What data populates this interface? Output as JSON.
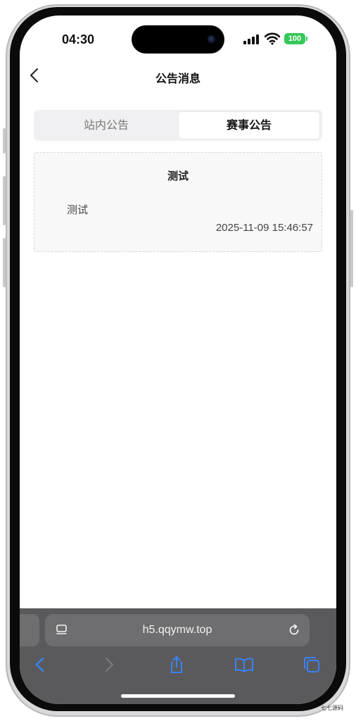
{
  "status_bar": {
    "time": "04:30",
    "battery": "100"
  },
  "nav": {
    "title": "公告消息"
  },
  "tabs": [
    {
      "label": "站内公告",
      "active": false
    },
    {
      "label": "赛事公告",
      "active": true
    }
  ],
  "notice": {
    "title": "测试",
    "body": "测试",
    "time": "2025-11-09 15:46:57"
  },
  "browser": {
    "url": "h5.qqymw.top"
  },
  "watermark": "七七源码",
  "colors": {
    "battery_green": "#35c759",
    "safari_icon_blue": "#3b82f6",
    "tab_bg": "#f0f0f2"
  }
}
